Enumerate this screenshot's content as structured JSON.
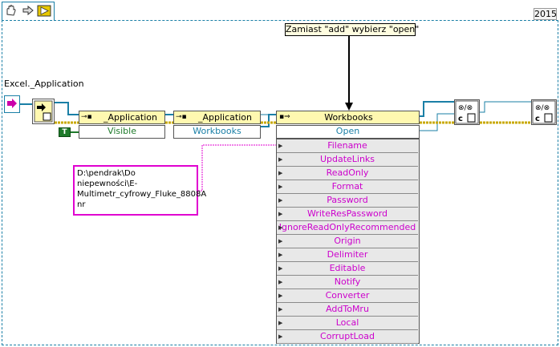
{
  "tab_icons": [
    "hand-icon",
    "arrow-icon",
    "run-icon"
  ],
  "year": "2015",
  "note": "Zamiast \"add\" wybierz \"open\"",
  "ref_label": "Excel._Application",
  "nodes": {
    "app1": {
      "title": "_Application",
      "prop": "Visible"
    },
    "app2": {
      "title": "_Application",
      "prop": "Workbooks"
    },
    "workbooks": {
      "title": "Workbooks",
      "method": "Open"
    }
  },
  "const_true": "T",
  "params": [
    "Filename",
    "UpdateLinks",
    "ReadOnly",
    "Format",
    "Password",
    "WriteResPassword",
    "IgnoreReadOnlyRecommended",
    "Origin",
    "Delimiter",
    "Editable",
    "Notify",
    "Converter",
    "AddToMru",
    "Local",
    "CorruptLoad"
  ],
  "path_text": "D:\\pendrak\\Do niepewności\\E-Multimetr_cyfrowy_Fluke_8808A nr",
  "colors": {
    "refwire": "#1a7fa6",
    "string": "#e000d0",
    "bool": "#1e7a2a",
    "error": "#c8a800"
  }
}
